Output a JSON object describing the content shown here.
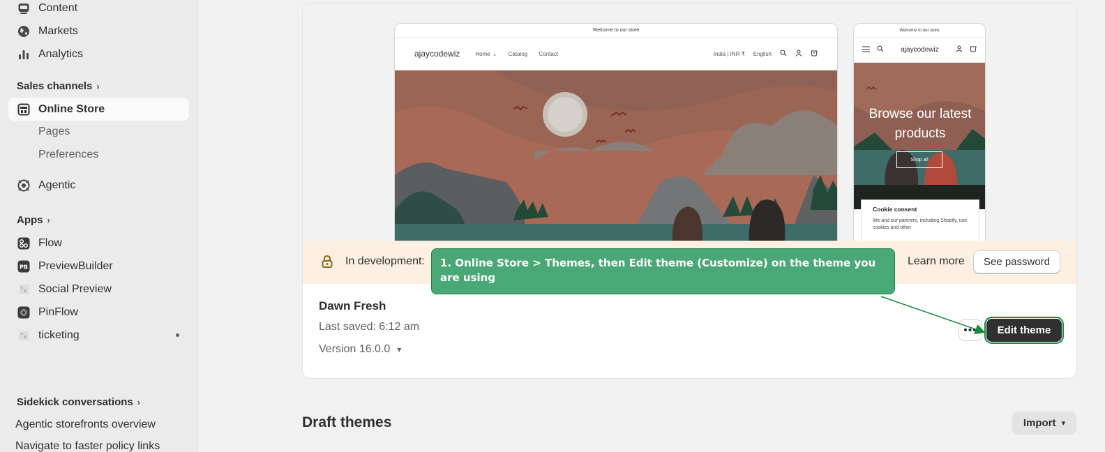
{
  "sidebar": {
    "content": "Content",
    "markets": "Markets",
    "analytics": "Analytics",
    "sales_channels": "Sales channels",
    "online_store": "Online Store",
    "pages": "Pages",
    "preferences": "Preferences",
    "agentic": "Agentic",
    "apps": "Apps",
    "flow": "Flow",
    "previewbuilder": "PreviewBuilder",
    "social_preview": "Social Preview",
    "pinflow": "PinFlow",
    "ticketing": "ticketing",
    "sidekick_conversations": "Sidekick conversations",
    "sk_1": "Agentic storefronts overview",
    "sk_2": "Navigate to faster policy links"
  },
  "preview": {
    "announcement": "Welcome to our store",
    "store_name": "ajaycodewiz",
    "nav": [
      "Home",
      "Catalog",
      "Contact"
    ],
    "country": "India | INR ₹",
    "language": "English",
    "hero_heading": "Browse our latest products",
    "shop_all": "Shop all",
    "cookie_title": "Cookie consent",
    "cookie_text": "We and our partners, including Shopify, use cookies and other"
  },
  "banner": {
    "status": "In development:",
    "learn_more": "Learn more",
    "see_password": "See password"
  },
  "theme": {
    "name": "Dawn Fresh",
    "last_saved": "Last saved: 6:12 am",
    "version": "Version 16.0.0",
    "more": "•••",
    "edit": "Edit theme"
  },
  "drafts": {
    "title": "Draft themes",
    "import": "Import"
  },
  "callout": {
    "text": "1. Online Store > Themes, then Edit theme (Customize) on the theme you are using"
  },
  "colors": {
    "callout_bg": "#4aa877",
    "callout_border": "#1f7d47",
    "dev_banner_bg": "#fdf0e2",
    "primary_button": "#303030"
  }
}
